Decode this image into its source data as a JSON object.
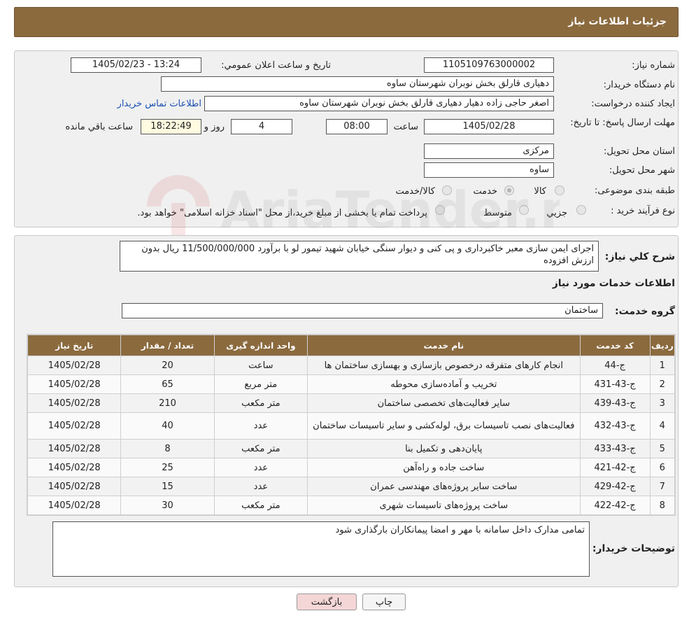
{
  "header": {
    "title": "جزئیات اطلاعات نیاز"
  },
  "form": {
    "need_number_label": "شماره نیاز:",
    "need_number": "1105109763000002",
    "announce_label": "تاریخ و ساعت اعلان عمومي:",
    "announce_value": "1405/02/23 - 13:24",
    "buyer_org_label": "نام دستگاه خريدار:",
    "buyer_org": "دهیاری قارلق  بخش نوبران شهرستان ساوه",
    "creator_label": "ايجاد کننده درخواست:",
    "creator": "اصغر حاجی زاده دهیار دهیاری قارلق  بخش نوبران شهرستان ساوه",
    "contact_link": "اطلاعات تماس خریدار",
    "deadline_label": "مهلت ارسال پاسخ: تا تاريخ:",
    "deadline_date": "1405/02/28",
    "time_label": "ساعت",
    "deadline_time": "08:00",
    "days_value": "4",
    "days_label": "روز و",
    "remaining_time": "18:22:49",
    "remaining_label": "ساعت باقي مانده",
    "province_label": "استان محل تحویل:",
    "province": "مرکزی",
    "city_label": "شهر محل تحویل:",
    "city": "ساوه",
    "category_label": "طبقه بندی موضوعی:",
    "category_options": [
      "کالا",
      "خدمت",
      "کالا/خدمت"
    ],
    "category_selected": "خدمت",
    "process_label": "نوع فرآيند خريد :",
    "process_options": [
      "جزیي",
      "متوسط"
    ],
    "process_note": "پرداخت تمام یا بخشی از مبلغ خرید،از محل \"اسناد خزانه اسلامی\" خواهد بود."
  },
  "description": {
    "label": "شرح کلي نياز:",
    "text": "اجرای ایمن سازی معبر خاکبرداری و پی کنی و دیوار سنگی خیابان شهید تیمور لو با برآورد 11/500/000/000 ریال بدون ارزش افزوده"
  },
  "services": {
    "title": "اطلاعات خدمات مورد نياز",
    "group_label": "گروه خدمت:",
    "group_value": "ساختمان",
    "columns": [
      "رديف",
      "کد خدمت",
      "نام خدمت",
      "واحد اندازه گيری",
      "تعداد / مقدار",
      "تاريخ نياز"
    ],
    "rows": [
      [
        "1",
        "ج-44",
        "انجام کارهای متفرقه درخصوص بازسازی و بهسازی ساختمان ها",
        "ساعت",
        "20",
        "1405/02/28"
      ],
      [
        "2",
        "ج-43-431",
        "تخریب و آماده‌سازی محوطه",
        "متر مربع",
        "65",
        "1405/02/28"
      ],
      [
        "3",
        "ج-43-439",
        "سایر فعالیت‌های تخصصی ساختمان",
        "متر مکعب",
        "210",
        "1405/02/28"
      ],
      [
        "4",
        "ج-43-432",
        "فعالیت‌های نصب تاسیسات برق، لوله‌کشی و سایر تاسیسات ساختمان",
        "عدد",
        "40",
        "1405/02/28"
      ],
      [
        "5",
        "ج-43-433",
        "پایان‌دهی و تکمیل بنا",
        "متر مکعب",
        "8",
        "1405/02/28"
      ],
      [
        "6",
        "ج-42-421",
        "ساخت جاده و راه‌آهن",
        "عدد",
        "25",
        "1405/02/28"
      ],
      [
        "7",
        "ج-42-429",
        "ساخت سایر پروژه‌های مهندسی عمران",
        "عدد",
        "15",
        "1405/02/28"
      ],
      [
        "8",
        "ج-42-422",
        "ساخت پروژه‌های تاسیسات شهری",
        "متر مکعب",
        "30",
        "1405/02/28"
      ]
    ]
  },
  "buyer_notes": {
    "label": "توضيحات خريدار:",
    "text": "تمامی مدارک داخل سامانه با مهر و امضا پیمانکاران بارگذاری شود"
  },
  "buttons": {
    "print": "چاپ",
    "back": "بازگشت"
  },
  "watermark": {
    "text": "AriaTender.neT"
  },
  "colors": {
    "header": "#8b6a3e",
    "back_button": "#f4d6d6",
    "link": "#1a4fb3"
  }
}
